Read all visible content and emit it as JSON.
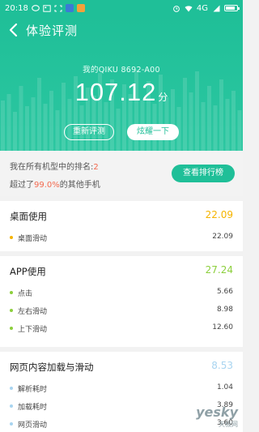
{
  "status_bar": {
    "time": "20:18",
    "network": "4G"
  },
  "header": {
    "title": "体验评测",
    "model": "我的QIKU 8692-A00",
    "score": "107.12",
    "score_unit": "分",
    "retest_label": "重新评测",
    "share_label": "炫耀一下"
  },
  "rank": {
    "prefix": "我在所有机型中的排名:",
    "position": "2",
    "beat_prefix": "超过了",
    "beat_percent": "99.0%",
    "beat_suffix": "的其他手机",
    "button_label": "查看排行榜"
  },
  "sections": [
    {
      "title": "桌面使用",
      "score": "22.09",
      "color": "#f5b400",
      "items": [
        {
          "label": "桌面滑动",
          "value": "22.09"
        }
      ]
    },
    {
      "title": "APP使用",
      "score": "27.24",
      "color": "#8ccf3c",
      "items": [
        {
          "label": "点击",
          "value": "5.66"
        },
        {
          "label": "左右滑动",
          "value": "8.98"
        },
        {
          "label": "上下滑动",
          "value": "12.60"
        }
      ]
    },
    {
      "title": "网页内容加载与滑动",
      "score": "8.53",
      "color": "#a8d4f0",
      "items": [
        {
          "label": "解析耗时",
          "value": "1.04"
        },
        {
          "label": "加载耗时",
          "value": "3.89"
        },
        {
          "label": "网页滑动",
          "value": "3.60"
        }
      ]
    }
  ],
  "watermark": {
    "main": "yesky",
    "sub": "天极网"
  },
  "colors": {
    "accent": "#1fbf98",
    "highlight": "#f36a4f"
  }
}
